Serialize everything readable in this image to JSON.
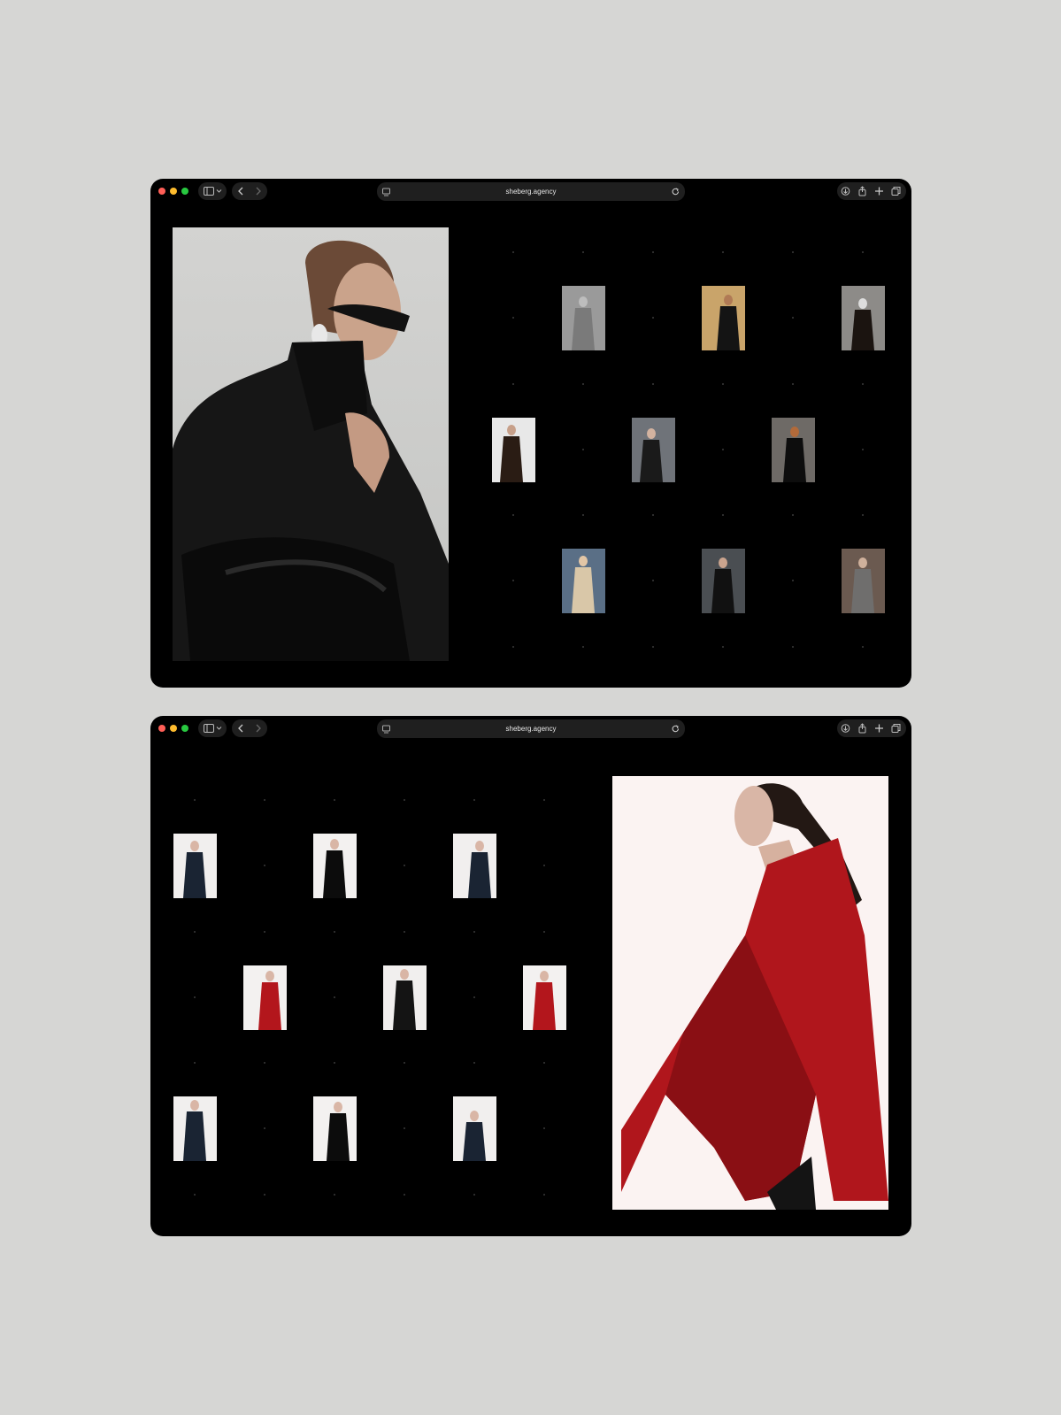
{
  "windows": [
    {
      "url": "sheberg.agency",
      "icons": {
        "sidebar": "sidebar-icon",
        "sidebar_dropdown": "chevron-down-icon",
        "back": "chevron-left-icon",
        "forward": "chevron-right-icon",
        "site": "site-icon",
        "reload": "reload-icon",
        "download": "download-icon",
        "share": "share-icon",
        "new_tab": "plus-icon",
        "tabs": "tabs-overview-icon"
      }
    },
    {
      "url": "sheberg.agency",
      "icons": {
        "sidebar": "sidebar-icon",
        "sidebar_dropdown": "chevron-down-icon",
        "back": "chevron-left-icon",
        "forward": "chevron-right-icon",
        "site": "site-icon",
        "reload": "reload-icon",
        "download": "download-icon",
        "share": "share-icon",
        "new_tab": "plus-icon",
        "tabs": "tabs-overview-icon"
      }
    }
  ],
  "colors": {
    "page_background": "#d6d6d4",
    "window_background": "#000000",
    "traffic_red": "#ff5f57",
    "traffic_yellow": "#febc2e",
    "traffic_green": "#28c840"
  }
}
